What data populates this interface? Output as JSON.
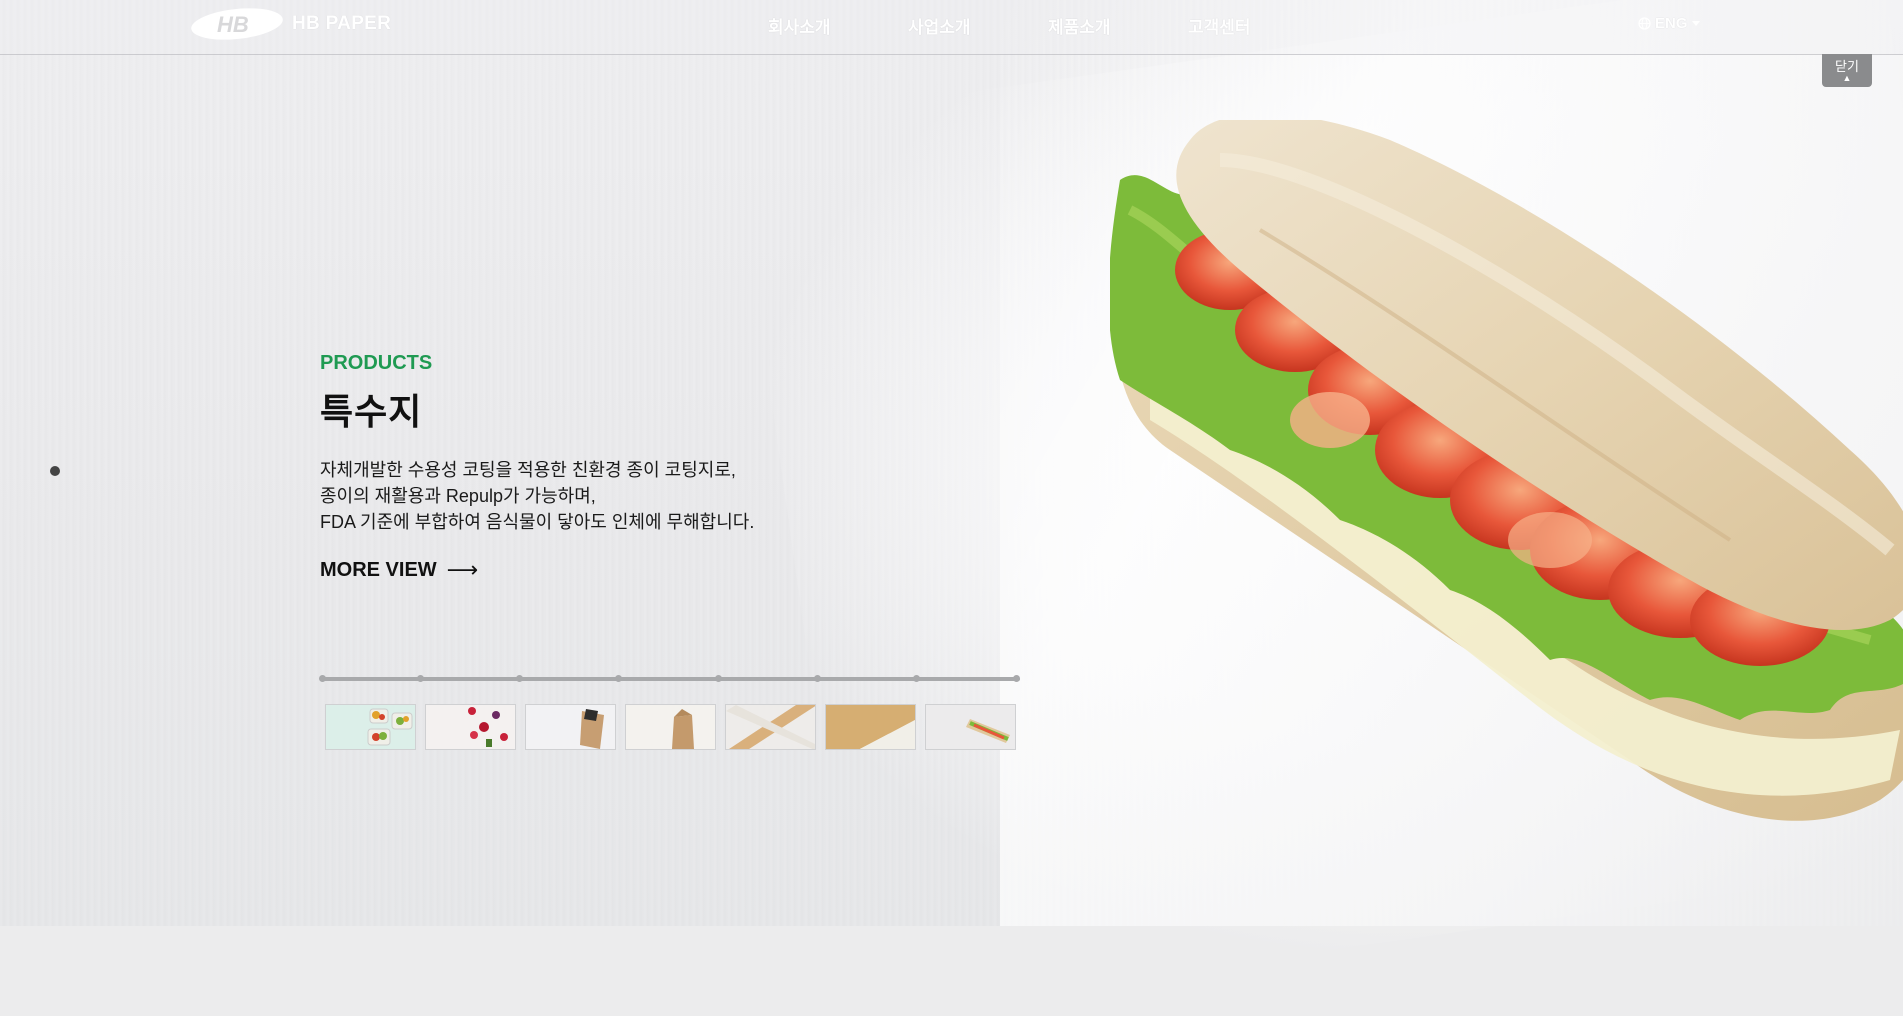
{
  "brand": {
    "name": "HB PAPER",
    "mark": "HB"
  },
  "nav": {
    "items": [
      {
        "label": "회사소개"
      },
      {
        "label": "사업소개"
      },
      {
        "label": "제품소개"
      },
      {
        "label": "고객센터"
      }
    ],
    "lang_label": "ENG",
    "lang_icon": "globe-icon",
    "close_label": "닫기",
    "close_icon": "caret-up-icon"
  },
  "hero": {
    "kicker": "PRODUCTS",
    "title": "특수지",
    "desc": [
      "자체개발한 수용성 코팅을 적용한 친환경 종이 코팅지로,",
      "종이의 재활용과 Repulp가 가능하며,",
      "FDA 기준에 부합하여 음식물이 닿아도 인체에 무해합니다."
    ],
    "more_label": "MORE VIEW",
    "more_arrow": "⟶"
  },
  "slider": {
    "tick_count": 8,
    "thumbnails": [
      {
        "name": "food-containers-thumb"
      },
      {
        "name": "berries-thumb"
      },
      {
        "name": "paper-bag-dark-thumb"
      },
      {
        "name": "kraft-bag-thumb"
      },
      {
        "name": "kraft-tape-thumb"
      },
      {
        "name": "kraft-sheet-thumb"
      },
      {
        "name": "sandwich-thumb"
      }
    ]
  },
  "colors": {
    "accent": "#1f9a52",
    "title": "#111111",
    "close_tab_bg": "#8a8b8d"
  }
}
